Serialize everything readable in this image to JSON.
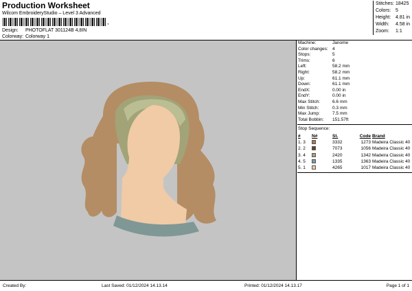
{
  "header": {
    "title": "Production Worksheet",
    "subtitle": "Wilcom EmbroideryStudio – Level 3 Advanced",
    "barcode_tail": ",",
    "design_label": "Design:",
    "design_value": "PHOTOFLAT 301124B 4,8IN",
    "colorway_label": "Colorway:",
    "colorway_value": "Colorway 1"
  },
  "stats": [
    {
      "label": "Stitches:",
      "value": "18425"
    },
    {
      "label": "Colors:",
      "value": "5"
    },
    {
      "label": "Height:",
      "value": "4.81 in"
    },
    {
      "label": "Width:",
      "value": "4.58 in"
    },
    {
      "label": "Zoom:",
      "value": "1:1"
    }
  ],
  "info": [
    {
      "label": "Machine:",
      "value": "Janome"
    },
    {
      "label": "Color changes:",
      "value": "4"
    },
    {
      "label": "Stops:",
      "value": "5"
    },
    {
      "label": "Trims:",
      "value": "6"
    },
    {
      "label": "Left:",
      "value": "58.2 mm"
    },
    {
      "label": "Right:",
      "value": "58.2 mm"
    },
    {
      "label": "Up:",
      "value": "61.1 mm"
    },
    {
      "label": "Down:",
      "value": "61.1 mm"
    },
    {
      "label": "EndX:",
      "value": "0.00 in"
    },
    {
      "label": "EndY:",
      "value": "0.00 in"
    },
    {
      "label": "Max Stitch:",
      "value": "6.6 mm"
    },
    {
      "label": "Min Stitch:",
      "value": "0.3 mm"
    },
    {
      "label": "Max Jump:",
      "value": "7.5 mm"
    },
    {
      "label": "Total Bobbin:",
      "value": "151.57ft"
    }
  ],
  "stop_sequence": {
    "title": "Stop Sequence:",
    "headers": [
      "#",
      "N#",
      "St.",
      "Code",
      "Brand"
    ],
    "rows": [
      {
        "num": "1.",
        "n": "3",
        "color": "#a77b57",
        "st": "3332",
        "code": "1273",
        "brand": "Madeira Classic 40"
      },
      {
        "num": "2.",
        "n": "2",
        "color": "#6d3f2b",
        "st": "7073",
        "code": "1056",
        "brand": "Madeira Classic 40"
      },
      {
        "num": "3.",
        "n": "4",
        "color": "#a8a575",
        "st": "2420",
        "code": "1342",
        "brand": "Madeira Classic 40"
      },
      {
        "num": "4.",
        "n": "5",
        "color": "#7f9aa6",
        "st": "1335",
        "code": "1363",
        "brand": "Madeira Classic 40"
      },
      {
        "num": "5.",
        "n": "1",
        "color": "#f0c9a4",
        "st": "4265",
        "code": "1017",
        "brand": "Madeira Classic 40"
      }
    ]
  },
  "colors": {
    "hair_brown": "#b48d64",
    "hair_olive": "#a2a377",
    "band_green": "#bbbd93",
    "face": "#f0cba6",
    "collar": "#7f9895",
    "background": "#c4c4c4"
  },
  "footer": {
    "created_by": "Created By:",
    "last_saved": "Last Saved: 01/12/2024 14.13.14",
    "printed": "Printed: 01/12/2024 14.13.17",
    "page": "Page 1 of 1"
  }
}
